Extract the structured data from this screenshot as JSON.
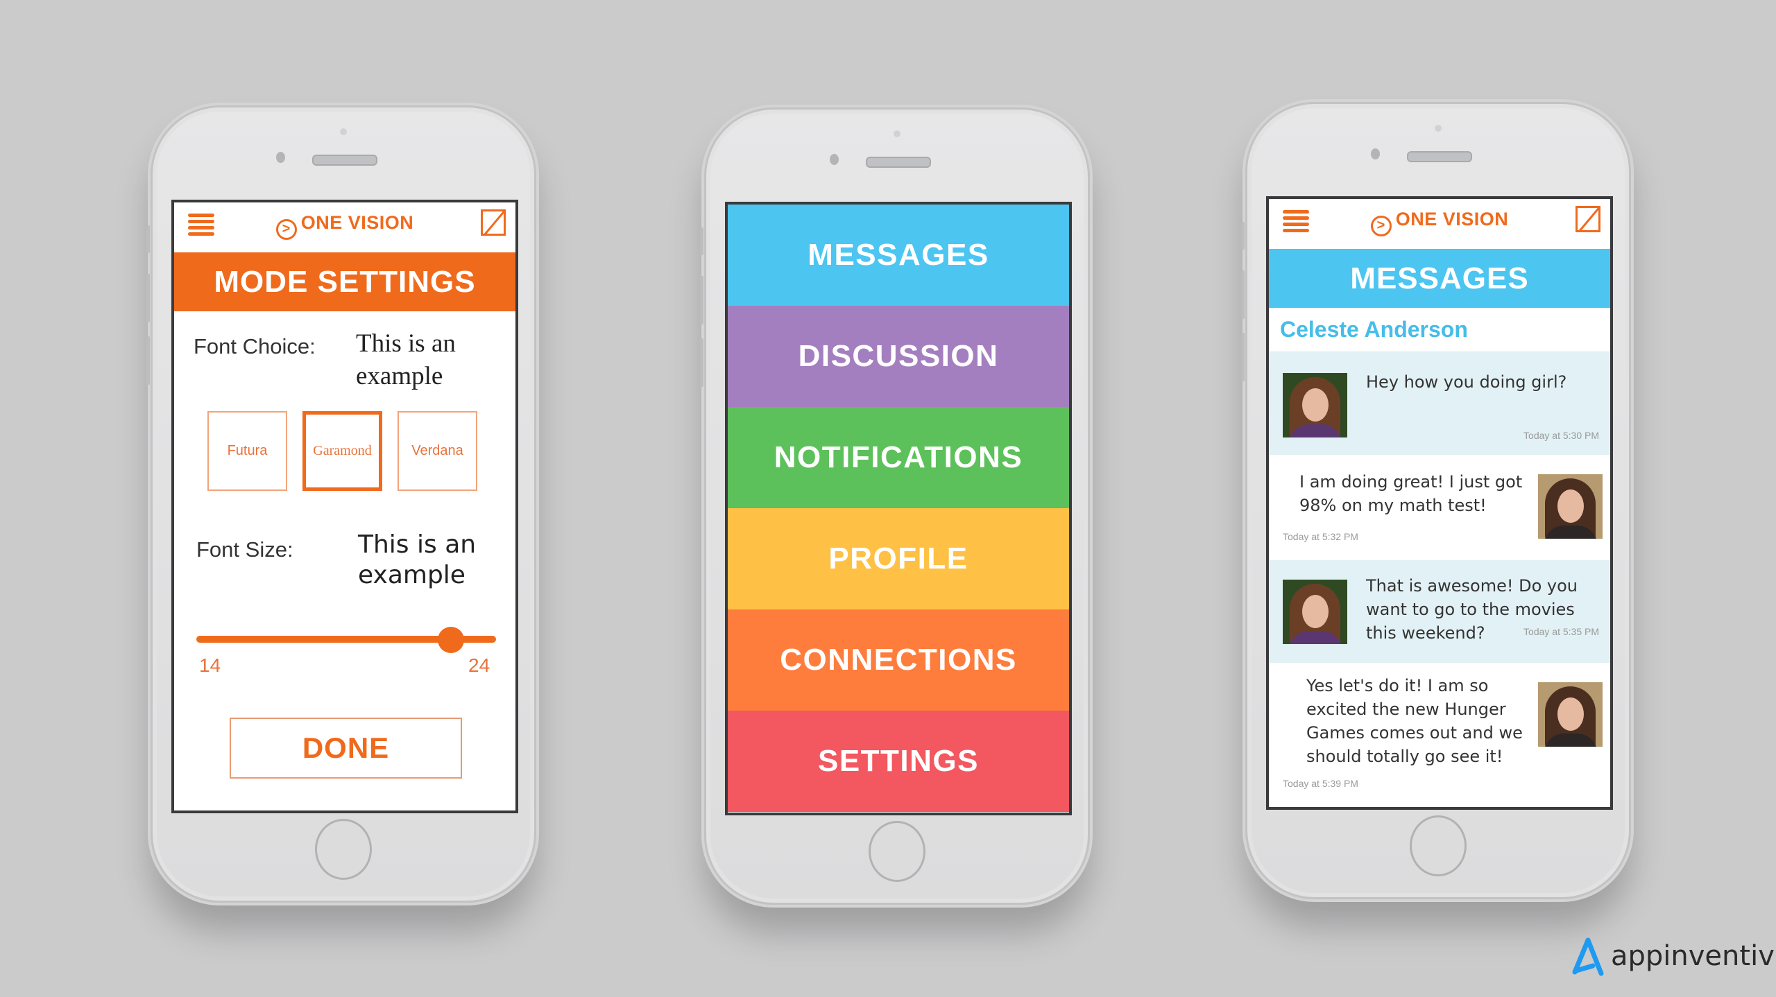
{
  "colors": {
    "background": "#cbcbcc",
    "brand_orange": "#f06a1c",
    "messages_blue": "#4cc5f0",
    "discussion_purple": "#a47fbf",
    "notifications_green": "#5cc15a",
    "profile_yellow": "#fec145",
    "connections_orange": "#fe7d3d",
    "settings_red": "#f3575f",
    "contact_blue": "#45bde9",
    "incoming_bubble": "#e2f1f5"
  },
  "app": {
    "brand_name": "ONE VISION",
    "brand_icon": "play-circle-icon"
  },
  "mode_settings": {
    "title": "MODE SETTINGS",
    "font_choice_label": "Font Choice:",
    "font_choice_sample": "This is an example",
    "font_options": [
      {
        "label": "Futura",
        "selected": false
      },
      {
        "label": "Garamond",
        "selected": true
      },
      {
        "label": "Verdana",
        "selected": false
      }
    ],
    "font_size_label": "Font Size:",
    "font_size_sample": "This is an example",
    "slider": {
      "min": "14",
      "max": "24",
      "fraction": 0.85
    },
    "done_label": "DONE"
  },
  "main_menu": {
    "items": [
      {
        "label": "MESSAGES",
        "color": "#4cc5f0"
      },
      {
        "label": "DISCUSSION",
        "color": "#a47fbf"
      },
      {
        "label": "NOTIFICATIONS",
        "color": "#5cc15a"
      },
      {
        "label": "PROFILE",
        "color": "#fec145"
      },
      {
        "label": "CONNECTIONS",
        "color": "#fe7d3d"
      },
      {
        "label": "SETTINGS",
        "color": "#f3575f"
      }
    ]
  },
  "messages_screen": {
    "title": "MESSAGES",
    "contact_name": "Celeste Anderson",
    "messages": [
      {
        "direction": "incoming",
        "text": "Hey how you doing girl?",
        "time": "Today at 5:30 PM"
      },
      {
        "direction": "outgoing",
        "text": "I am doing great! I just got 98% on my math test!",
        "time": "Today at 5:32 PM"
      },
      {
        "direction": "incoming",
        "text": "That is awesome! Do you want to go to the movies this weekend?",
        "time": "Today at 5:35 PM"
      },
      {
        "direction": "outgoing",
        "text": "Yes let's do it!  I am so excited the new Hunger Games comes out and we should totally go see it!",
        "time": "Today at 5:39 PM"
      }
    ]
  },
  "watermark": {
    "text": "appinventiv",
    "icon": "appinventiv-logo-icon"
  }
}
